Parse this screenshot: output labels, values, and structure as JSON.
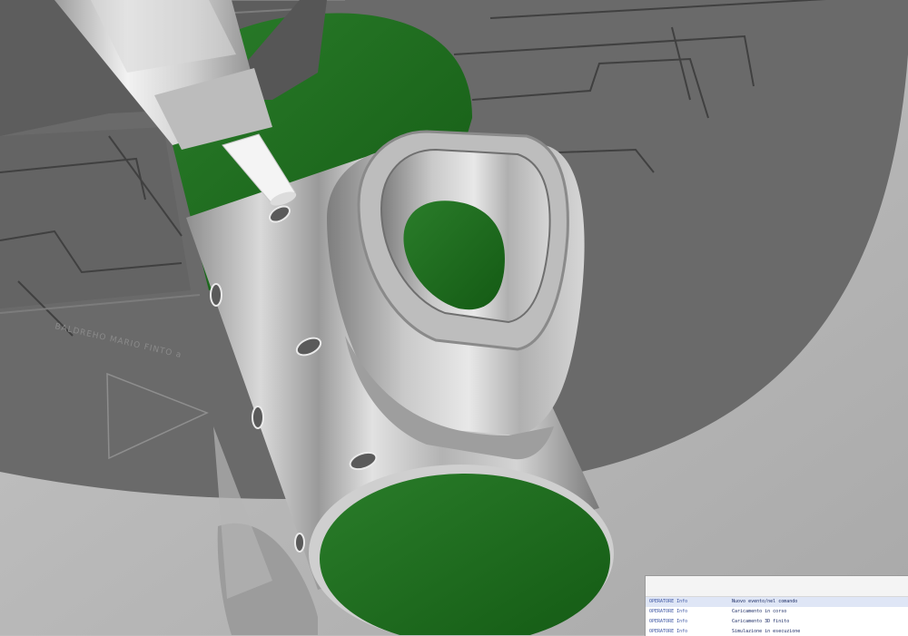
{
  "app": {
    "view": "cnc-simulation-3d-view"
  },
  "workpiece": {
    "engraving_text": "BALDREHO MARIO FINTO a"
  },
  "colors": {
    "table": "#6b6b6b",
    "table_dark": "#4f4f4f",
    "stock_green": "#1f6b1f",
    "part_metal": "#c9c9c9",
    "tool_metal": "#e3e3e3",
    "background": "#bdbdbd"
  },
  "icons": {
    "direction_marker": "triangle-outline-icon"
  },
  "log_panel": {
    "lines": [
      {
        "source": "OPERATORE Info",
        "message": "Nuovo evento/nel comando"
      },
      {
        "source": "OPERATORE Info",
        "message": "Caricamento in corso"
      },
      {
        "source": "OPERATORE Info",
        "message": "Caricamento 3D finito"
      },
      {
        "source": "OPERATORE Info",
        "message": "Simulazione in esecuzione"
      }
    ]
  }
}
